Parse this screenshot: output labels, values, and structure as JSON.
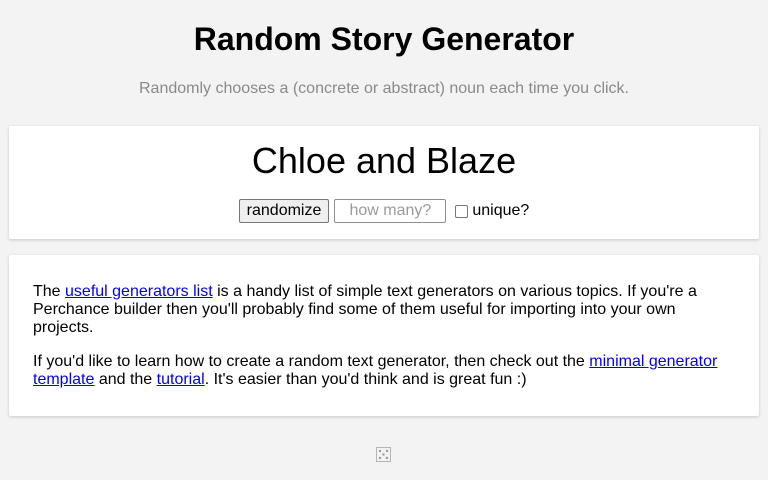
{
  "header": {
    "title": "Random Story Generator",
    "subtitle": "Randomly chooses a (concrete or abstract) noun each time you click."
  },
  "output": {
    "text": "Chloe and Blaze"
  },
  "controls": {
    "randomize_label": "randomize",
    "count_placeholder": "how many?",
    "count_value": "",
    "unique_label": "unique?",
    "unique_checked": false
  },
  "info": {
    "p1_before": "The ",
    "p1_link": "useful generators list",
    "p1_after": " is a handy list of simple text generators on various topics. If you're a Perchance builder then you'll probably find some of them useful for importing into your own projects.",
    "p2_before": "If you'd like to learn how to create a random text generator, then check out the ",
    "p2_link1": "minimal generator template",
    "p2_mid": " and the ",
    "p2_link2": "tutorial",
    "p2_after": ". It's easier than you'd think and is great fun :)"
  },
  "footer": {
    "icon": "dice-icon"
  },
  "colors": {
    "background": "#f3f3f3",
    "card": "#ffffff",
    "link": "#0000ee",
    "subtitle": "#8a8a8a"
  }
}
